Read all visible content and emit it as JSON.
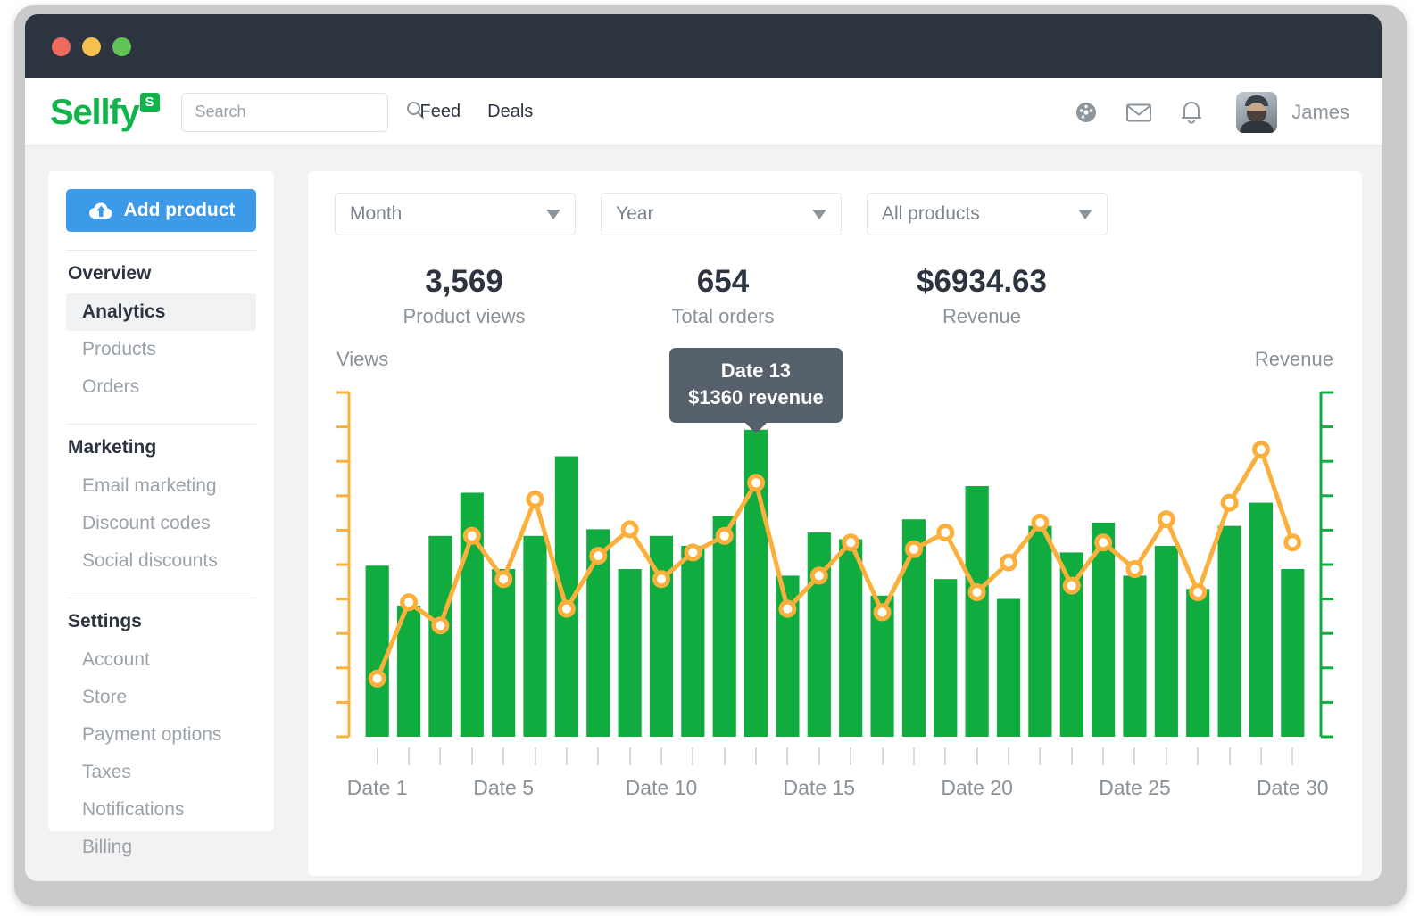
{
  "window": {
    "traffic_lights": [
      "close",
      "minimize",
      "maximize"
    ]
  },
  "header": {
    "brand_wordmark": "Sellfy",
    "brand_badge": "S",
    "search": {
      "value": "",
      "placeholder": "Search"
    },
    "nav": [
      {
        "label": "Feed"
      },
      {
        "label": "Deals"
      }
    ],
    "icons": [
      {
        "name": "dashboard-gauge-icon"
      },
      {
        "name": "mail-icon"
      },
      {
        "name": "bell-icon"
      }
    ],
    "username": "James"
  },
  "sidebar": {
    "add_product_label": "Add product",
    "groups": [
      {
        "title": "Overview",
        "items": [
          {
            "label": "Analytics",
            "active": true
          },
          {
            "label": "Products",
            "active": false
          },
          {
            "label": "Orders",
            "active": false
          }
        ]
      },
      {
        "title": "Marketing",
        "items": [
          {
            "label": "Email marketing",
            "active": false
          },
          {
            "label": "Discount codes",
            "active": false
          },
          {
            "label": "Social discounts",
            "active": false
          }
        ]
      },
      {
        "title": "Settings",
        "items": [
          {
            "label": "Account",
            "active": false
          },
          {
            "label": "Store",
            "active": false
          },
          {
            "label": "Payment options",
            "active": false
          },
          {
            "label": "Taxes",
            "active": false
          },
          {
            "label": "Notifications",
            "active": false
          },
          {
            "label": "Billing",
            "active": false
          }
        ]
      }
    ]
  },
  "filters": [
    {
      "name": "period-select",
      "selected": "Month"
    },
    {
      "name": "year-select",
      "selected": "Year"
    },
    {
      "name": "product-select",
      "selected": "All products"
    }
  ],
  "stats": [
    {
      "value": "3,569",
      "label": "Product views"
    },
    {
      "value": "654",
      "label": "Total orders"
    },
    {
      "value": "$6934.63",
      "label": "Revenue"
    }
  ],
  "tooltip": {
    "line1": "Date 13",
    "line2": "$1360 revenue",
    "anchor_index": 12
  },
  "colors": {
    "brand_green": "#12b34a",
    "bar_green": "#10ac40",
    "line_orange": "#fbb03b",
    "accent_blue": "#3d9ae8",
    "tooltip_gray": "#56616c",
    "text_dark": "#2c3440",
    "text_muted": "#8a9299",
    "titlebar": "#2c3440"
  },
  "chart_data": {
    "type": "bar",
    "title": "",
    "xlabel": "",
    "left_axis_label": "Views",
    "right_axis_label": "Revenue",
    "grid": false,
    "legend_position": "none",
    "x_tick_labels": [
      "Date 1",
      "Date 5",
      "Date 10",
      "Date 15",
      "Date 20",
      "Date 25",
      "Date 30"
    ],
    "x_tick_indices": [
      0,
      4,
      9,
      14,
      19,
      24,
      29
    ],
    "categories": [
      "Date 1",
      "Date 2",
      "Date 3",
      "Date 4",
      "Date 5",
      "Date 6",
      "Date 7",
      "Date 8",
      "Date 9",
      "Date 10",
      "Date 11",
      "Date 12",
      "Date 13",
      "Date 14",
      "Date 15",
      "Date 16",
      "Date 17",
      "Date 18",
      "Date 19",
      "Date 20",
      "Date 21",
      "Date 22",
      "Date 23",
      "Date 24",
      "Date 25",
      "Date 26",
      "Date 27",
      "Date 28",
      "Date 29",
      "Date 30"
    ],
    "series": [
      {
        "name": "Views",
        "type": "bar",
        "color": "#10ac40",
        "axis": "right",
        "ylim": [
          0,
          100
        ],
        "values": [
          51,
          39,
          60,
          73,
          50,
          60,
          84,
          62,
          50,
          60,
          57,
          66,
          92,
          48,
          61,
          59,
          42,
          65,
          47,
          75,
          41,
          63,
          55,
          64,
          48,
          57,
          44,
          63,
          70,
          50
        ]
      },
      {
        "name": "Revenue",
        "type": "line",
        "color": "#fbb03b",
        "axis": "left",
        "ylim": [
          0,
          100
        ],
        "values": [
          17,
          40,
          33,
          60,
          47,
          71,
          38,
          54,
          62,
          47,
          55,
          60,
          76,
          38,
          48,
          58,
          37,
          56,
          61,
          43,
          52,
          64,
          45,
          58,
          50,
          65,
          43,
          70,
          86,
          58
        ]
      }
    ]
  }
}
